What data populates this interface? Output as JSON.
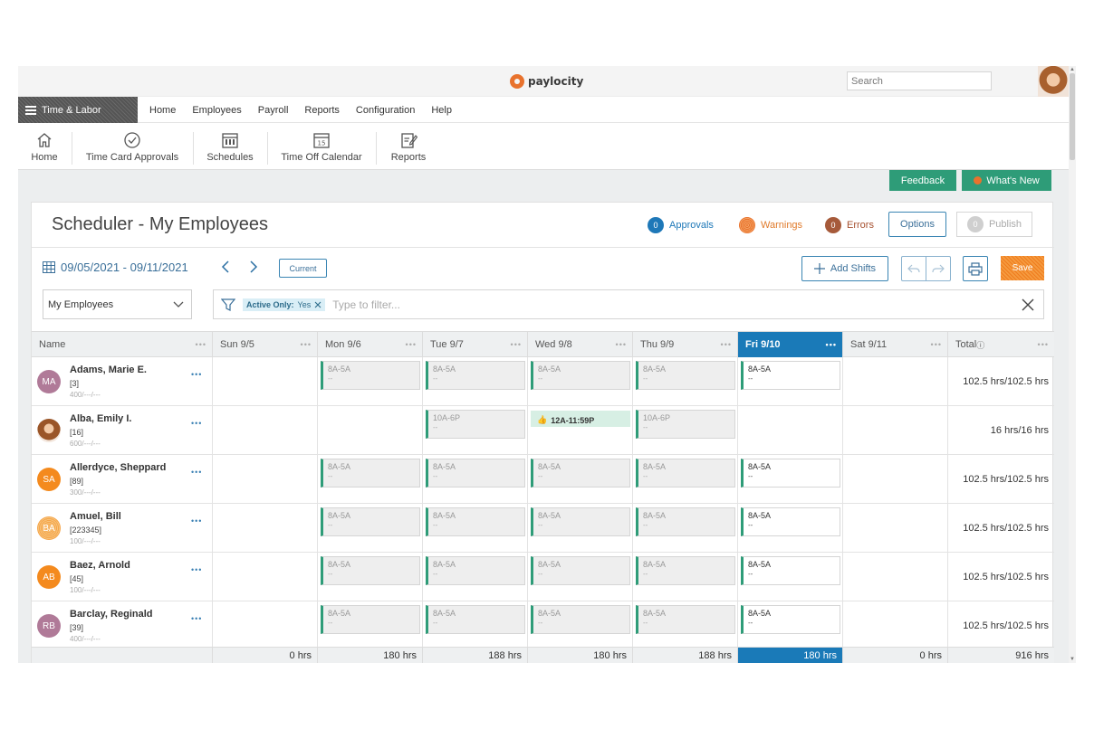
{
  "topbar": {
    "logo_text": "paylocity",
    "search_placeholder": "Search"
  },
  "mainnav": {
    "module_label": "Time & Labor",
    "items": [
      "Home",
      "Employees",
      "Payroll",
      "Reports",
      "Configuration",
      "Help"
    ]
  },
  "subnav": {
    "items": [
      {
        "label": "Home",
        "icon": "home-icon"
      },
      {
        "label": "Time Card Approvals",
        "icon": "check-circle-icon"
      },
      {
        "label": "Schedules",
        "icon": "calendar-grid-icon"
      },
      {
        "label": "Time Off Calendar",
        "icon": "calendar-15-icon"
      },
      {
        "label": "Reports",
        "icon": "report-edit-icon"
      }
    ]
  },
  "actions": {
    "feedback": "Feedback",
    "whats_new": "What's New"
  },
  "panel": {
    "title": "Scheduler - My Employees",
    "approvals": {
      "count": "0",
      "label": "Approvals"
    },
    "warnings": {
      "label": "Warnings"
    },
    "errors": {
      "count": "0",
      "label": "Errors"
    },
    "options": "Options",
    "publish": {
      "count": "0",
      "label": "Publish"
    },
    "date_range": "09/05/2021 - 09/11/2021",
    "current": "Current",
    "add_shifts": "Add Shifts",
    "save": "Save",
    "employee_filter": "My Employees",
    "filter_chip": {
      "key": "Active Only:",
      "value": "Yes"
    },
    "filter_placeholder": "Type to filter..."
  },
  "grid": {
    "headers": [
      "Name",
      "Sun 9/5",
      "Mon 9/6",
      "Tue 9/7",
      "Wed 9/8",
      "Thu 9/9",
      "Fri 9/10",
      "Sat 9/11",
      "Total"
    ],
    "rows": [
      {
        "name": "Adams, Marie E.",
        "id": "[3]",
        "code": "400/---/---",
        "initials": "MA",
        "shifts": [
          "",
          "8A-5A",
          "8A-5A",
          "8A-5A",
          "8A-5A",
          "8A-5A",
          ""
        ],
        "total": "102.5 hrs/102.5 hrs"
      },
      {
        "name": "Alba, Emily I.",
        "id": "[16]",
        "code": "600/---/---",
        "initials": "",
        "shifts": [
          "",
          "",
          "10A-6P",
          "12A-11:59P",
          "10A-6P",
          "",
          ""
        ],
        "total": "16 hrs/16 hrs"
      },
      {
        "name": "Allerdyce, Sheppard",
        "id": "[89]",
        "code": "300/---/---",
        "initials": "SA",
        "shifts": [
          "",
          "8A-5A",
          "8A-5A",
          "8A-5A",
          "8A-5A",
          "8A-5A",
          ""
        ],
        "total": "102.5 hrs/102.5 hrs"
      },
      {
        "name": "Amuel, Bill",
        "id": "[223345]",
        "code": "100/---/---",
        "initials": "BA",
        "shifts": [
          "",
          "8A-5A",
          "8A-5A",
          "8A-5A",
          "8A-5A",
          "8A-5A",
          ""
        ],
        "total": "102.5 hrs/102.5 hrs"
      },
      {
        "name": "Baez, Arnold",
        "id": "[45]",
        "code": "100/---/---",
        "initials": "AB",
        "shifts": [
          "",
          "8A-5A",
          "8A-5A",
          "8A-5A",
          "8A-5A",
          "8A-5A",
          ""
        ],
        "total": "102.5 hrs/102.5 hrs"
      },
      {
        "name": "Barclay, Reginald",
        "id": "[39]",
        "code": "400/---/---",
        "initials": "RB",
        "shifts": [
          "",
          "8A-5A",
          "8A-5A",
          "8A-5A",
          "8A-5A",
          "8A-5A",
          ""
        ],
        "total": "102.5 hrs/102.5 hrs"
      }
    ],
    "shift_sub": "--",
    "footer": [
      "",
      "0 hrs",
      "180 hrs",
      "188 hrs",
      "180 hrs",
      "188 hrs",
      "180 hrs",
      "0 hrs",
      "916 hrs"
    ]
  },
  "colors": {
    "accent_green": "#2e9c78",
    "today_blue": "#1a7ab8",
    "save_orange": "#ef7b1e"
  }
}
